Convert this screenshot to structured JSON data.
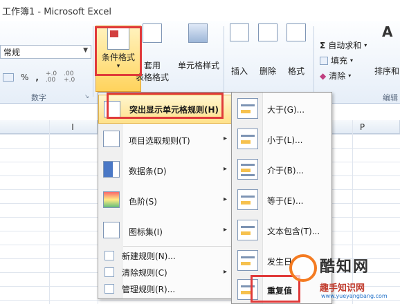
{
  "window": {
    "title": "工作簿1  -  Microsoft Excel"
  },
  "ribbon": {
    "number_format_value": "常规",
    "percent_label": "%",
    "comma_label": ",",
    "inc_decimal_label": "+.0\n.00",
    "dec_decimal_label": ".00\n+.0",
    "number_group_label": "数字",
    "cond_format_label": "条件格式",
    "cond_format_caret": "▾",
    "table_format_line1": "套用",
    "table_format_line2": "表格格式",
    "cell_style_label": "单元格样式",
    "insert_label": "插入",
    "delete_label": "删除",
    "format_label": "格式",
    "autosum_label": "自动求和",
    "fill_label": "填充",
    "clear_label": "清除",
    "sort_label": "排序和",
    "edit_group_label": "编辑"
  },
  "columns": [
    "I",
    "J",
    "P"
  ],
  "menu": {
    "items": [
      {
        "label": "突出显示单元格规则(H)",
        "active": true
      },
      {
        "label": "项目选取规则(T)"
      },
      {
        "label": "数据条(D)"
      },
      {
        "label": "色阶(S)"
      },
      {
        "label": "图标集(I)"
      }
    ],
    "small_items": [
      {
        "label": "新建规则(N)..."
      },
      {
        "label": "清除规则(C)"
      },
      {
        "label": "管理规则(R)..."
      }
    ],
    "submenu_arrow": "▸"
  },
  "submenu": {
    "items": [
      {
        "label": "大于(G)..."
      },
      {
        "label": "小于(L)..."
      },
      {
        "label": "介于(B)..."
      },
      {
        "label": "等于(E)..."
      },
      {
        "label": "文本包含(T)..."
      },
      {
        "label": "发生日"
      },
      {
        "label": "重复值"
      }
    ]
  },
  "watermark": {
    "brand": "酷知网",
    "subtitle": "趣手知识网",
    "url": "www.yueyangbang.com"
  }
}
